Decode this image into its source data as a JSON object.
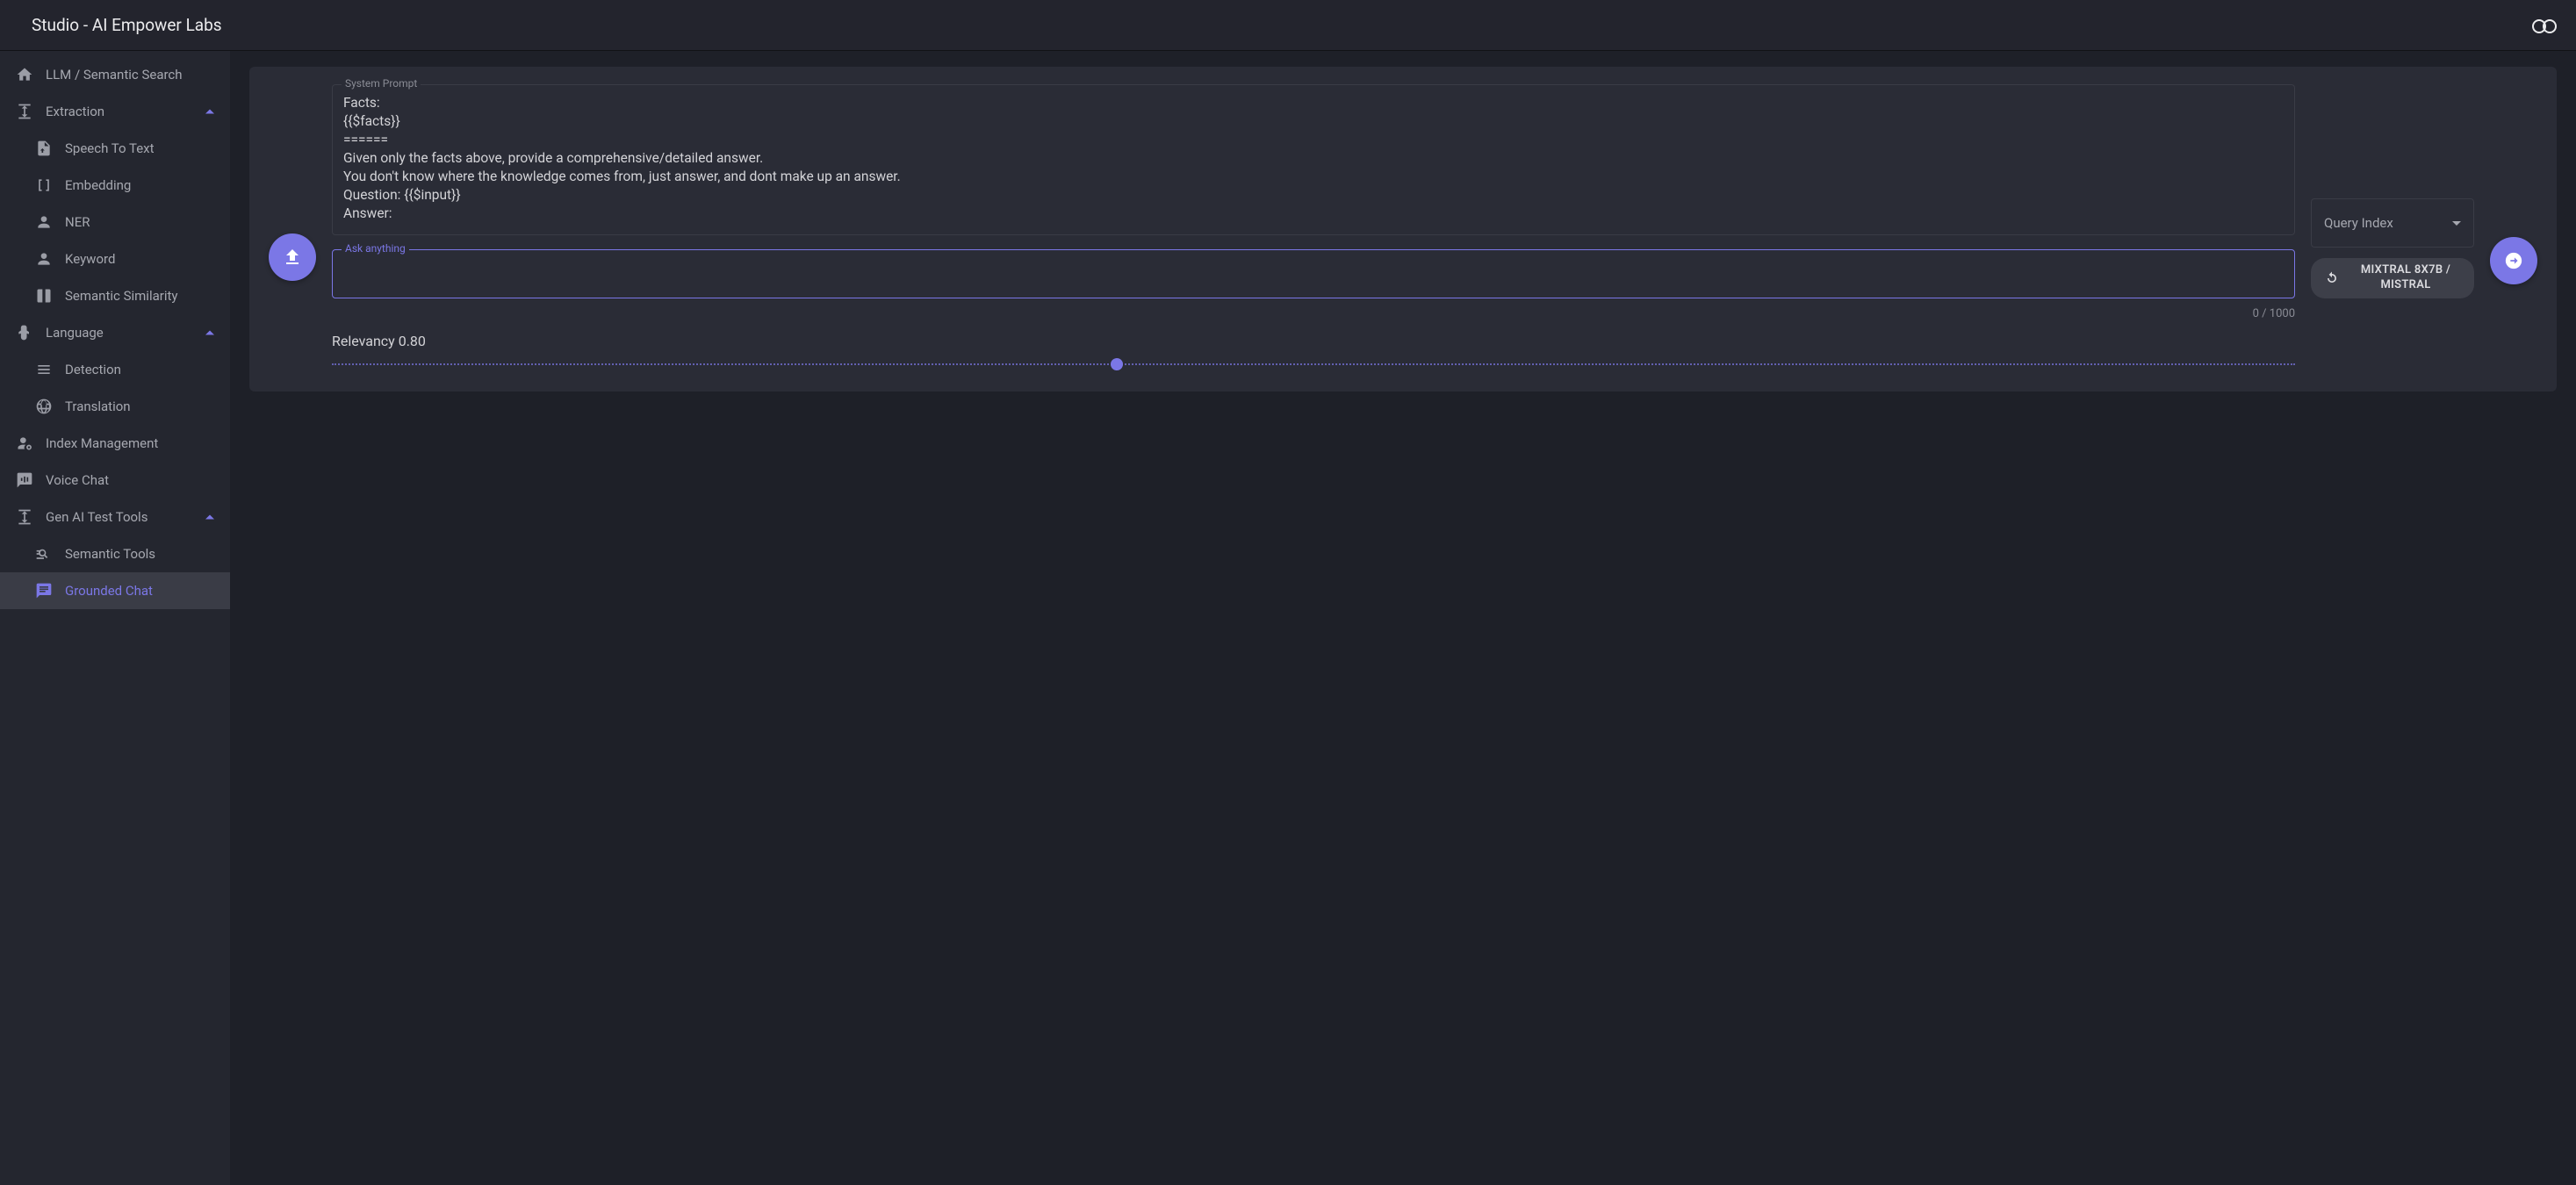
{
  "header": {
    "title": "Studio - AI Empower Labs"
  },
  "sidebar": {
    "llm_search": "LLM / Semantic Search",
    "extraction": {
      "label": "Extraction",
      "items": {
        "speech_to_text": "Speech To Text",
        "embedding": "Embedding",
        "ner": "NER",
        "keyword": "Keyword",
        "semantic_similarity": "Semantic Similarity"
      }
    },
    "language": {
      "label": "Language",
      "items": {
        "detection": "Detection",
        "translation": "Translation"
      }
    },
    "index_management": "Index Management",
    "voice_chat": "Voice Chat",
    "gen_ai": {
      "label": "Gen AI Test Tools",
      "items": {
        "semantic_tools": "Semantic Tools",
        "grounded_chat": "Grounded Chat"
      }
    }
  },
  "main": {
    "system_prompt_label": "System Prompt",
    "system_prompt_value": "Facts:\n{{$facts}}\n======\nGiven only the facts above, provide a comprehensive/detailed answer.\nYou don't know where the knowledge comes from, just answer, and dont make up an answer.\nQuestion: {{$input}}\nAnswer:",
    "ask_label": "Ask anything",
    "ask_value": "",
    "char_count": "0 / 1000",
    "relevancy_label": "Relevancy 0.80",
    "relevancy_value": 0.8,
    "query_index_label": "Query Index",
    "model_label": "MIXTRAL 8X7B / MISTRAL"
  }
}
